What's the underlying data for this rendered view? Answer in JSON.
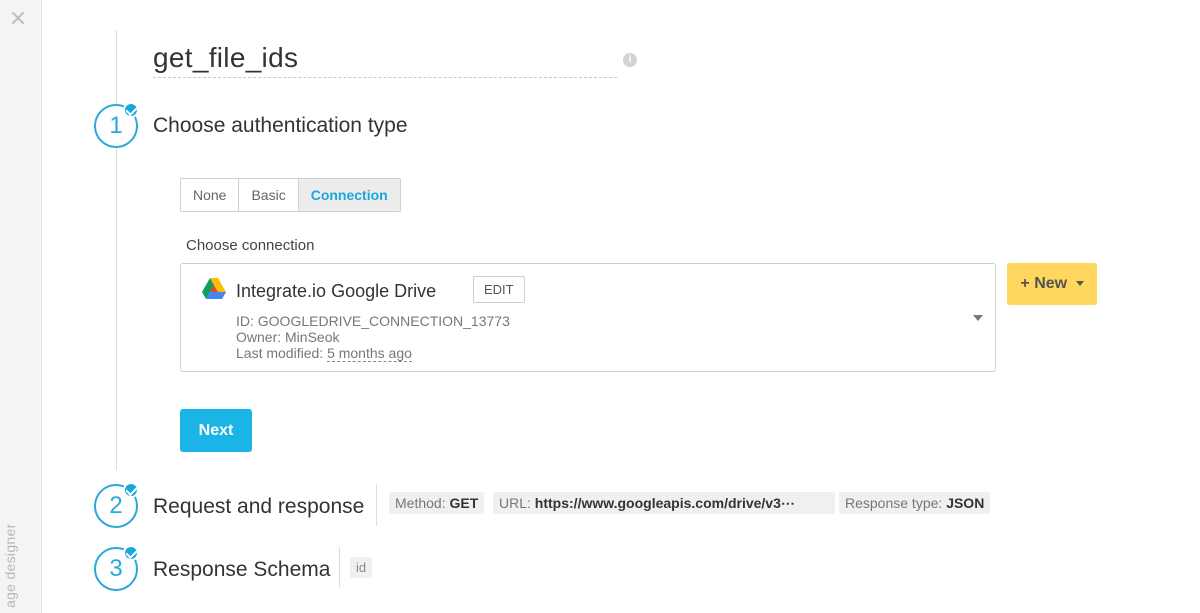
{
  "sidebar": {
    "vertical_label": "age designer"
  },
  "title": "get_file_ids",
  "steps": [
    {
      "number": "1",
      "title": "Choose authentication type"
    },
    {
      "number": "2",
      "title": "Request and response"
    },
    {
      "number": "3",
      "title": "Response Schema"
    }
  ],
  "auth": {
    "options": [
      "None",
      "Basic",
      "Connection"
    ],
    "selected": "Connection"
  },
  "connection": {
    "label": "Choose connection",
    "name": "Integrate.io Google Drive",
    "edit_label": "EDIT",
    "id_line": "ID: GOOGLEDRIVE_CONNECTION_13773",
    "owner_line": "Owner: MinSeok",
    "modified_prefix": "Last modified: ",
    "modified_value": "5 months ago"
  },
  "new_button": {
    "plus": "+",
    "label": "New"
  },
  "next_label": "Next",
  "request": {
    "method_label": "Method:",
    "method_value": "GET",
    "url_label": "URL:",
    "url_value": "https://www.googleapis.com/drive/v3⋯",
    "response_label": "Response type:",
    "response_value": "JSON"
  },
  "schema": {
    "fields": [
      "id"
    ]
  },
  "colors": {
    "accent": "#1aa7de",
    "new_button": "#ffd75e",
    "next_button": "#1ab5e6"
  },
  "icons": [
    "close-icon",
    "info-icon",
    "check-icon",
    "google-drive-icon",
    "chevron-down-icon"
  ]
}
